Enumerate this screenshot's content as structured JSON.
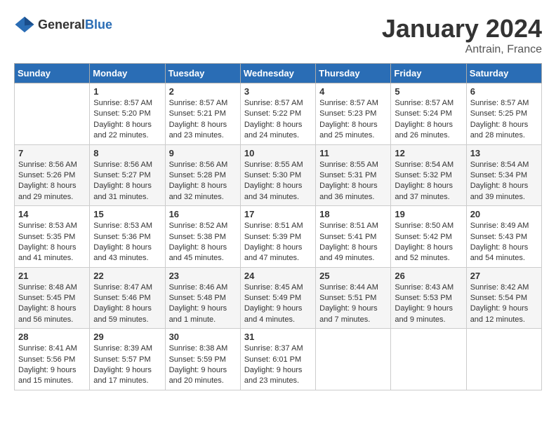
{
  "logo": {
    "general": "General",
    "blue": "Blue"
  },
  "title": "January 2024",
  "location": "Antrain, France",
  "weekdays": [
    "Sunday",
    "Monday",
    "Tuesday",
    "Wednesday",
    "Thursday",
    "Friday",
    "Saturday"
  ],
  "weeks": [
    [
      {
        "day": "",
        "sunrise": "",
        "sunset": "",
        "daylight": ""
      },
      {
        "day": "1",
        "sunrise": "Sunrise: 8:57 AM",
        "sunset": "Sunset: 5:20 PM",
        "daylight": "Daylight: 8 hours and 22 minutes."
      },
      {
        "day": "2",
        "sunrise": "Sunrise: 8:57 AM",
        "sunset": "Sunset: 5:21 PM",
        "daylight": "Daylight: 8 hours and 23 minutes."
      },
      {
        "day": "3",
        "sunrise": "Sunrise: 8:57 AM",
        "sunset": "Sunset: 5:22 PM",
        "daylight": "Daylight: 8 hours and 24 minutes."
      },
      {
        "day": "4",
        "sunrise": "Sunrise: 8:57 AM",
        "sunset": "Sunset: 5:23 PM",
        "daylight": "Daylight: 8 hours and 25 minutes."
      },
      {
        "day": "5",
        "sunrise": "Sunrise: 8:57 AM",
        "sunset": "Sunset: 5:24 PM",
        "daylight": "Daylight: 8 hours and 26 minutes."
      },
      {
        "day": "6",
        "sunrise": "Sunrise: 8:57 AM",
        "sunset": "Sunset: 5:25 PM",
        "daylight": "Daylight: 8 hours and 28 minutes."
      }
    ],
    [
      {
        "day": "7",
        "sunrise": "Sunrise: 8:56 AM",
        "sunset": "Sunset: 5:26 PM",
        "daylight": "Daylight: 8 hours and 29 minutes."
      },
      {
        "day": "8",
        "sunrise": "Sunrise: 8:56 AM",
        "sunset": "Sunset: 5:27 PM",
        "daylight": "Daylight: 8 hours and 31 minutes."
      },
      {
        "day": "9",
        "sunrise": "Sunrise: 8:56 AM",
        "sunset": "Sunset: 5:28 PM",
        "daylight": "Daylight: 8 hours and 32 minutes."
      },
      {
        "day": "10",
        "sunrise": "Sunrise: 8:55 AM",
        "sunset": "Sunset: 5:30 PM",
        "daylight": "Daylight: 8 hours and 34 minutes."
      },
      {
        "day": "11",
        "sunrise": "Sunrise: 8:55 AM",
        "sunset": "Sunset: 5:31 PM",
        "daylight": "Daylight: 8 hours and 36 minutes."
      },
      {
        "day": "12",
        "sunrise": "Sunrise: 8:54 AM",
        "sunset": "Sunset: 5:32 PM",
        "daylight": "Daylight: 8 hours and 37 minutes."
      },
      {
        "day": "13",
        "sunrise": "Sunrise: 8:54 AM",
        "sunset": "Sunset: 5:34 PM",
        "daylight": "Daylight: 8 hours and 39 minutes."
      }
    ],
    [
      {
        "day": "14",
        "sunrise": "Sunrise: 8:53 AM",
        "sunset": "Sunset: 5:35 PM",
        "daylight": "Daylight: 8 hours and 41 minutes."
      },
      {
        "day": "15",
        "sunrise": "Sunrise: 8:53 AM",
        "sunset": "Sunset: 5:36 PM",
        "daylight": "Daylight: 8 hours and 43 minutes."
      },
      {
        "day": "16",
        "sunrise": "Sunrise: 8:52 AM",
        "sunset": "Sunset: 5:38 PM",
        "daylight": "Daylight: 8 hours and 45 minutes."
      },
      {
        "day": "17",
        "sunrise": "Sunrise: 8:51 AM",
        "sunset": "Sunset: 5:39 PM",
        "daylight": "Daylight: 8 hours and 47 minutes."
      },
      {
        "day": "18",
        "sunrise": "Sunrise: 8:51 AM",
        "sunset": "Sunset: 5:41 PM",
        "daylight": "Daylight: 8 hours and 49 minutes."
      },
      {
        "day": "19",
        "sunrise": "Sunrise: 8:50 AM",
        "sunset": "Sunset: 5:42 PM",
        "daylight": "Daylight: 8 hours and 52 minutes."
      },
      {
        "day": "20",
        "sunrise": "Sunrise: 8:49 AM",
        "sunset": "Sunset: 5:43 PM",
        "daylight": "Daylight: 8 hours and 54 minutes."
      }
    ],
    [
      {
        "day": "21",
        "sunrise": "Sunrise: 8:48 AM",
        "sunset": "Sunset: 5:45 PM",
        "daylight": "Daylight: 8 hours and 56 minutes."
      },
      {
        "day": "22",
        "sunrise": "Sunrise: 8:47 AM",
        "sunset": "Sunset: 5:46 PM",
        "daylight": "Daylight: 8 hours and 59 minutes."
      },
      {
        "day": "23",
        "sunrise": "Sunrise: 8:46 AM",
        "sunset": "Sunset: 5:48 PM",
        "daylight": "Daylight: 9 hours and 1 minute."
      },
      {
        "day": "24",
        "sunrise": "Sunrise: 8:45 AM",
        "sunset": "Sunset: 5:49 PM",
        "daylight": "Daylight: 9 hours and 4 minutes."
      },
      {
        "day": "25",
        "sunrise": "Sunrise: 8:44 AM",
        "sunset": "Sunset: 5:51 PM",
        "daylight": "Daylight: 9 hours and 7 minutes."
      },
      {
        "day": "26",
        "sunrise": "Sunrise: 8:43 AM",
        "sunset": "Sunset: 5:53 PM",
        "daylight": "Daylight: 9 hours and 9 minutes."
      },
      {
        "day": "27",
        "sunrise": "Sunrise: 8:42 AM",
        "sunset": "Sunset: 5:54 PM",
        "daylight": "Daylight: 9 hours and 12 minutes."
      }
    ],
    [
      {
        "day": "28",
        "sunrise": "Sunrise: 8:41 AM",
        "sunset": "Sunset: 5:56 PM",
        "daylight": "Daylight: 9 hours and 15 minutes."
      },
      {
        "day": "29",
        "sunrise": "Sunrise: 8:39 AM",
        "sunset": "Sunset: 5:57 PM",
        "daylight": "Daylight: 9 hours and 17 minutes."
      },
      {
        "day": "30",
        "sunrise": "Sunrise: 8:38 AM",
        "sunset": "Sunset: 5:59 PM",
        "daylight": "Daylight: 9 hours and 20 minutes."
      },
      {
        "day": "31",
        "sunrise": "Sunrise: 8:37 AM",
        "sunset": "Sunset: 6:01 PM",
        "daylight": "Daylight: 9 hours and 23 minutes."
      },
      {
        "day": "",
        "sunrise": "",
        "sunset": "",
        "daylight": ""
      },
      {
        "day": "",
        "sunrise": "",
        "sunset": "",
        "daylight": ""
      },
      {
        "day": "",
        "sunrise": "",
        "sunset": "",
        "daylight": ""
      }
    ]
  ]
}
